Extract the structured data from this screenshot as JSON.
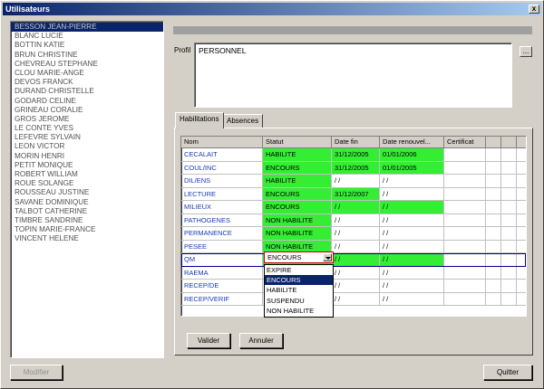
{
  "window": {
    "title": "Utilisateurs",
    "close": "x"
  },
  "users": [
    "BESSON JEAN-PIERRE",
    "BLANC LUCIE",
    "BOTTIN KATIE",
    "BRUN CHRISTINE",
    "CHEVREAU STEPHANE",
    "CLOU MARIE-ANGE",
    "DEVOS FRANCK",
    "DURAND CHRISTELLE",
    "GODARD CELINE",
    "GRINEAU CORALIE",
    "GROS JEROME",
    "LE CONTE YVES",
    "LEFEVRE SYLVAIN",
    "LEON VICTOR",
    "MORIN HENRI",
    "PETIT MONIQUE",
    "ROBERT WILLIAM",
    "ROUE SOLANGE",
    "ROUSSEAU JUSTINE",
    "SAVANE DOMINIQUE",
    "TALBOT CATHERINE",
    "TIMBRE SANDRINE",
    "TOPIN MARIE-FRANCE",
    "VINCENT HELENE"
  ],
  "selected_user_index": 0,
  "profil": {
    "label": "Profil",
    "value": "PERSONNEL",
    "button": "..."
  },
  "tabs": [
    {
      "label": "Habilitations",
      "active": true
    },
    {
      "label": "Absences",
      "active": false
    }
  ],
  "grid": {
    "columns": [
      "Nom",
      "Statut",
      "Date fin",
      "Date renouvel...",
      "Certificat",
      "",
      "",
      ""
    ],
    "rows": [
      {
        "nom": "CECALAIT",
        "statut": "HABILITE",
        "date_fin": "31/12/2005",
        "date_renouvel": "01/01/2006"
      },
      {
        "nom": "COUL/INC",
        "statut": "ENCOURS",
        "date_fin": "31/12/2005",
        "date_renouvel": "01/01/2005"
      },
      {
        "nom": "DIL/ENS",
        "statut": "HABILITE",
        "date_fin": " / /",
        "date_renouvel": " / /"
      },
      {
        "nom": "LECTURE",
        "statut": "ENCOURS",
        "date_fin": "31/12/2007",
        "date_renouvel": " / /"
      },
      {
        "nom": "MILIEUX",
        "statut": "ENCOURS",
        "date_fin": " / /",
        "date_renouvel": " / /"
      },
      {
        "nom": "PATHOGENES",
        "statut": "NON HABILITE",
        "date_fin": " / /",
        "date_renouvel": " / /"
      },
      {
        "nom": "PERMANENCE",
        "statut": "NON HABILITE",
        "date_fin": " / /",
        "date_renouvel": " / /"
      },
      {
        "nom": "PESEE",
        "statut": "NON HABILITE",
        "date_fin": " / /",
        "date_renouvel": " / /"
      },
      {
        "nom": "QM",
        "statut": "ENCOURS",
        "date_fin": " / /",
        "date_renouvel": " / /"
      },
      {
        "nom": "RAEMA",
        "statut": "",
        "date_fin": " / /",
        "date_renouvel": " / /"
      },
      {
        "nom": "RECEP/DE",
        "statut": "",
        "date_fin": " / /",
        "date_renouvel": " / /"
      },
      {
        "nom": "RECEP/VERIF",
        "statut": "",
        "date_fin": " / /",
        "date_renouvel": " / /"
      }
    ]
  },
  "status_combo": {
    "value": "ENCOURS",
    "options": [
      "EXPIRE",
      "ENCOURS",
      "HABILITE",
      "SUSPENDU",
      "NON HABILITE"
    ],
    "highlighted": "ENCOURS"
  },
  "buttons": {
    "valider": "Valider",
    "annuler": "Annuler",
    "modifier": "Modifier",
    "quitter": "Quitter"
  }
}
